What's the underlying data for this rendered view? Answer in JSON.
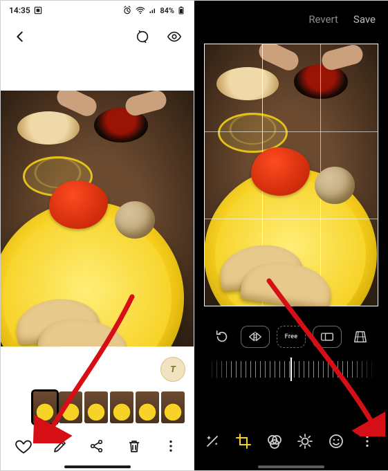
{
  "status": {
    "time": "14:35",
    "battery_pct": "84%"
  },
  "viewer": {
    "bixby_chip": "T",
    "actions": {
      "favorite": "Favorite",
      "edit": "Edit",
      "share": "Share",
      "delete": "Delete",
      "more": "More"
    },
    "thumbnails_count": 6
  },
  "editor": {
    "revert": "Revert",
    "save": "Save",
    "crop_tools": {
      "rotate": "Rotate",
      "flip_h": "Flip horizontal",
      "free_label": "Free",
      "ratio": "Aspect ratio",
      "perspective": "Perspective"
    },
    "modes": {
      "auto": "Auto",
      "crop": "Crop",
      "filters": "Filters",
      "adjust": "Adjust",
      "stickers": "Stickers",
      "more": "More options"
    },
    "active_mode": "crop"
  },
  "colors": {
    "accent": "#f7d327",
    "arrow": "#d60f16"
  }
}
